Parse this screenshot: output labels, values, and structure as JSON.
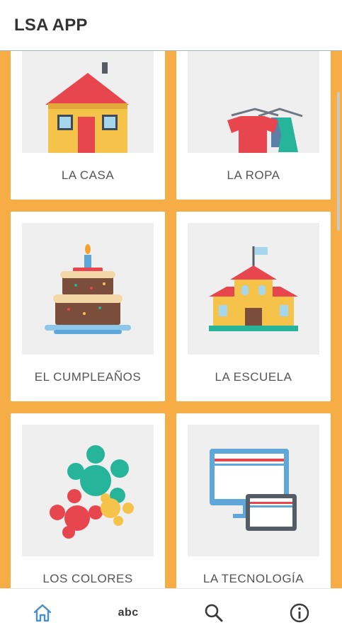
{
  "app": {
    "title": "LSA APP"
  },
  "categories": [
    {
      "label": "LA CASA",
      "icon": "house-icon"
    },
    {
      "label": "LA ROPA",
      "icon": "clothes-icon"
    },
    {
      "label": "EL CUMPLEAÑOS",
      "icon": "birthday-cake-icon"
    },
    {
      "label": "LA ESCUELA",
      "icon": "school-icon"
    },
    {
      "label": "LOS COLORES",
      "icon": "paint-splash-icon"
    },
    {
      "label": "LA TECNOLOGÍA",
      "icon": "computer-tablet-icon"
    }
  ],
  "bottom_nav": {
    "items": [
      {
        "icon": "home-icon",
        "active": true
      },
      {
        "label": "abc",
        "icon": "abc-icon"
      },
      {
        "icon": "search-icon"
      },
      {
        "icon": "info-icon"
      }
    ]
  },
  "colors": {
    "background": "#f7ad45",
    "active_nav": "#4a90c8",
    "card": "#ffffff",
    "thumb_bg": "#efefef"
  }
}
